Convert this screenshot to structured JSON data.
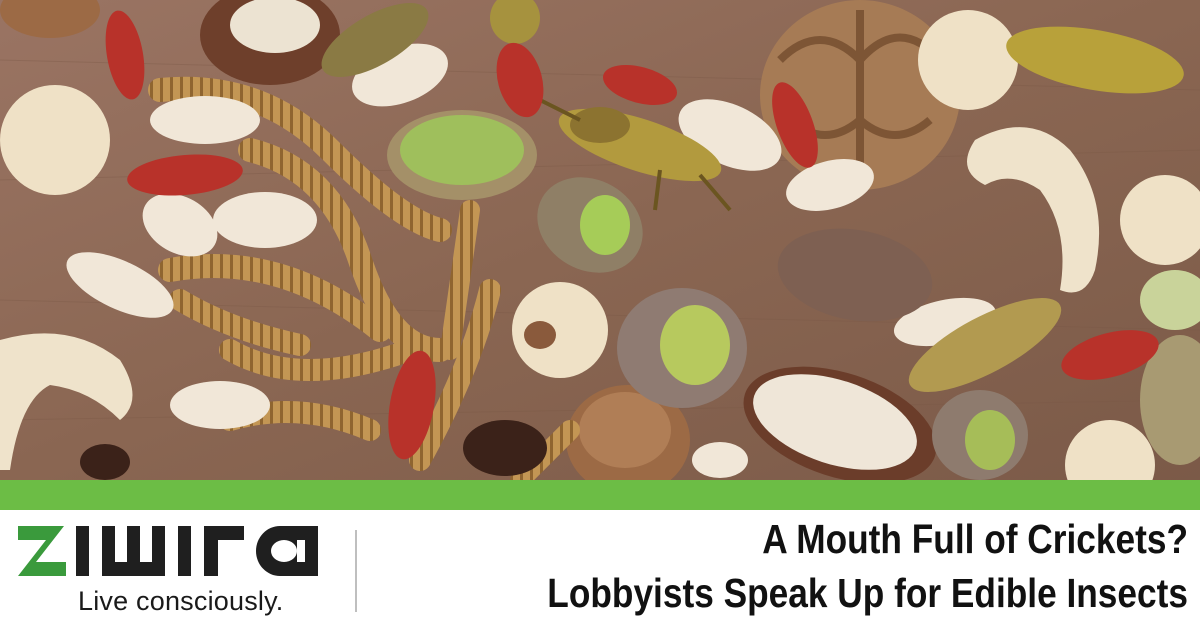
{
  "photo": {
    "subject": "mixed-nuts-and-insects-photo",
    "colors": {
      "board": "#8a6652",
      "mealworm": "#b98a4a",
      "goji": "#b8322a",
      "pistachio": "#9fb75a",
      "cashew": "#efe3cb"
    }
  },
  "brand": {
    "logo_text": "ziwira",
    "tagline": "Live consciously.",
    "colors": {
      "logo_green": "#3a9a3c",
      "logo_dark": "#1f1f1f",
      "bar_green": "#6cbd45"
    }
  },
  "headline": {
    "line1": "A Mouth Full of Crickets?",
    "line2": "Lobbyists Speak Up for Edible Insects"
  }
}
